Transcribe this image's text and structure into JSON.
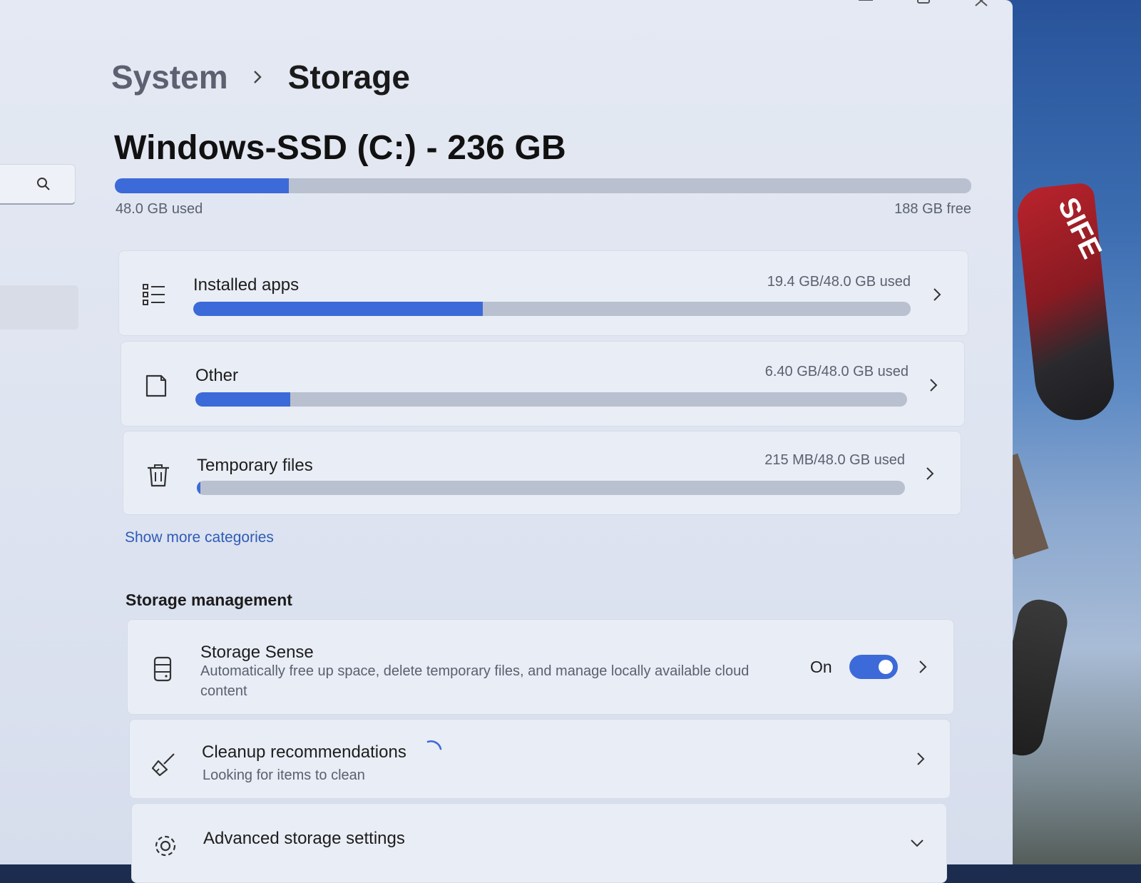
{
  "breadcrumb": {
    "parent": "System",
    "current": "Storage"
  },
  "drive": {
    "title": "Windows-SSD (C:) - 236 GB",
    "used_label": "48.0 GB used",
    "free_label": "188 GB free",
    "used_fraction": 0.203
  },
  "categories": [
    {
      "label": "Installed apps",
      "usage": "19.4 GB/48.0 GB used",
      "fraction": 0.404,
      "icon": "list-icon"
    },
    {
      "label": "Other",
      "usage": "6.40 GB/48.0 GB used",
      "fraction": 0.133,
      "icon": "document-icon"
    },
    {
      "label": "Temporary files",
      "usage": "215 MB/48.0 GB used",
      "fraction": 0.004,
      "icon": "trash-icon"
    }
  ],
  "show_more_label": "Show more categories",
  "storage_management": {
    "heading": "Storage management",
    "storage_sense": {
      "title": "Storage Sense",
      "description": "Automatically free up space, delete temporary files, and manage locally available cloud content",
      "state_label": "On",
      "enabled": true,
      "icon": "drive-icon"
    },
    "cleanup": {
      "title": "Cleanup recommendations",
      "subtitle": "Looking for items to clean",
      "icon": "broom-icon"
    },
    "advanced": {
      "title": "Advanced storage settings",
      "icon": "gear-icon"
    }
  },
  "colors": {
    "accent": "#3c6ad8",
    "track": "#b9c0cf",
    "link": "#2f5bb7",
    "window_bg": "#e2e7f2"
  }
}
